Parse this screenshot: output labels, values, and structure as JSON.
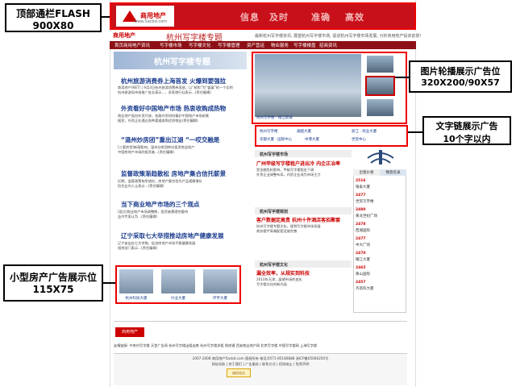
{
  "callouts": {
    "top_flash": {
      "line1": "顶部通栏FLASH",
      "line2": "900X80"
    },
    "carousel": {
      "line1": "图片轮播展示广告位",
      "line2": "320X200/90X57"
    },
    "text_links": {
      "line1": "文字链展示广告",
      "line2": "10个字以内"
    },
    "small_ads": {
      "line1": "小型房产广告展示位",
      "line2": "115X75"
    }
  },
  "flash": {
    "logo_name": "商用地产",
    "logo_url": "www.5acbd.com",
    "slogans": [
      "信息",
      "及时",
      "准确",
      "高效"
    ]
  },
  "header": {
    "logo": "商用地产",
    "title": "杭州写字楼专题",
    "desc": "最新杭州写字楼资讯, 展望杭州写字楼市场, 促进杭州写字楼市场发展, 分析商用地产投资前景!"
  },
  "nav": [
    "首页商用地产资讯",
    "写字楼市场",
    "写字楼文化",
    "写字楼管理",
    "资产营运",
    "物业服务",
    "写字楼楼盘",
    "招商资讯"
  ],
  "left": {
    "banner": "杭州写字楼专题",
    "articles": [
      {
        "title": "杭州旅游消费券上海首发 火爆到要强拉",
        "lines": [
          "商用地产(NET) | 9月3日杭州旅游消费券发放，以“抢购”为“盛宴”的一个实例",
          "杭州旅游局市场推广处长表示...，多家旅行社表示...(责任编辑)"
        ]
      },
      {
        "title": "外资看好中国地产市场 热衷收购成热物",
        "lines": [
          "商业地产面向外资开放，各路外资纷纷看好中国地产市场前景",
          "据悉，外资正在通过各种渠道收购优质物业(责任编辑)"
        ]
      },
      {
        "title": "“温州炒房团”重出江湖 “一哎交融是",
        "lines": [
          "[二套房贷]新政影响，温州炒房团转向投资商业地产",
          "中国房地产市场的投资者...(责任编辑)"
        ]
      },
      {
        "title": "监督政策渐趋散松 房地产集合信托薪景",
        "lines": [
          "近期，监管政策有所放松，房地产集合信托产品规模增长",
          "信托业内人士表示...(责任编辑)"
        ]
      },
      {
        "title": "当下商业地产市场的三个观点",
        "lines": [
          "[观点]商业地产市场调整期，投资者需理性看待",
          "业内专家认为...(责任编辑)"
        ]
      },
      {
        "title": "辽宁采取七大举措推动房地产健康发展",
        "lines": [
          "辽宁省出台七大举措，促进房地产市场平稳健康发展",
          "相关部门表示...(责任编辑)"
        ]
      }
    ],
    "small_ads": [
      "杭州科技大厦",
      "兴业大厦",
      "环宇大厦"
    ]
  },
  "carousel": {
    "caption": "杭州写字楼 · 钱江新城"
  },
  "text_links": [
    "杭州写字楼",
    "通越大厦",
    "浙江 · 商业大厦",
    "华都大厦 · 国际中心",
    "中港大厦",
    "世贸中心",
    "杭州写字楼",
    "中港大厦"
  ],
  "sections": [
    {
      "head": "杭州写字楼市场",
      "title": "广州甲级写字楼租户进出冷 内企正冶率",
      "lines": [
        "受金融危机影响，甲级写字楼租金下调",
        "外资企业调整布局，内资企业成为市场主力"
      ]
    },
    {
      "head": "杭州写字楼规划",
      "title": "客户数据定高贵 杭州十件酒店客招聚套",
      "lines": [
        "杭州写字楼专题文化，规划写字楼市场发展",
        "商务楼宇高端配套设施完善"
      ]
    },
    {
      "head": "杭州写字楼文化",
      "title": "漏全效率，从规实到科技",
      "lines": [
        "2010年天津，展望市场的变化",
        "写字楼文化的新内涵"
      ]
    }
  ],
  "price_tabs": [
    "出租价格",
    "楼盘名录"
  ],
  "prices": [
    {
      "num": "2516",
      "name": "银泰大厦"
    },
    {
      "num": "2477",
      "name": "世贸写字楼"
    },
    {
      "num": "2480",
      "name": "黄龙世纪广场"
    },
    {
      "num": "2478",
      "name": "西湖国际"
    },
    {
      "num": "2477",
      "name": "中大广场"
    },
    {
      "num": "2470",
      "name": "耀江大厦"
    },
    {
      "num": "2465",
      "name": "黄山国际"
    },
    {
      "num": "2457",
      "name": "齐高科大厦"
    }
  ],
  "bottom": {
    "logo": "商用地产",
    "friend_links": "友情链接: 中关村写字楼  天堂广告网  杭州写字楼出租出售  杭州写字楼求租  购房通  西安商业地产网  北京写字楼  中国写字楼网  上海写字楼"
  },
  "footer": {
    "line1": "2007-2008 商用地产5acbd.com 版权所有 电话:0571-85180888 浙ICP备05006250号",
    "line2": "网站导航 | 关于我们 | 广告服务 | 联系方式 | 招贤纳士 | 免责声明",
    "badge": "诚信站点"
  }
}
